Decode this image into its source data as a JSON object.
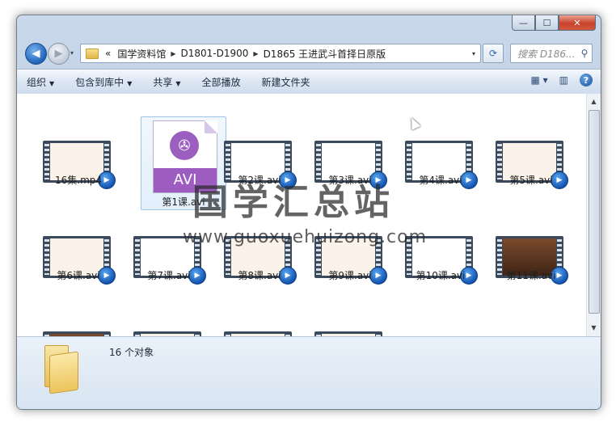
{
  "window": {
    "caption_buttons": {
      "minimize": "—",
      "maximize": "☐",
      "close": "✕"
    }
  },
  "address": {
    "recent_arrow": "▾",
    "overflow": "«",
    "crumbs": [
      "国学资料馆",
      "D1801-D1900",
      "D1865 王进武斗首择日原版"
    ],
    "dropdown": "▾"
  },
  "search": {
    "placeholder": "搜索 D186..."
  },
  "toolbar": {
    "organize": "组织",
    "include_library": "包含到库中",
    "share": "共享",
    "play_all": "全部播放",
    "new_folder": "新建文件夹"
  },
  "files": [
    {
      "name": "16集.mp4",
      "thumb": "doc"
    },
    {
      "name": "第1课.avi",
      "thumb": "avi-icon"
    },
    {
      "name": "第2课.avi",
      "thumb": "blank"
    },
    {
      "name": "第3课.avi",
      "thumb": "blank"
    },
    {
      "name": "第4课.avi",
      "thumb": "blank"
    },
    {
      "name": "第5课.avi",
      "thumb": "doc"
    },
    {
      "name": "第6课.avi",
      "thumb": "doc"
    },
    {
      "name": "第7课.avi",
      "thumb": "blank"
    },
    {
      "name": "第8课.avi",
      "thumb": "doc"
    },
    {
      "name": "第9课.avi",
      "thumb": "doc"
    },
    {
      "name": "第10课.avi",
      "thumb": "blank"
    },
    {
      "name": "第11课.avi",
      "thumb": "dark"
    }
  ],
  "avi_icon_text": "AVI",
  "watermark": {
    "cn": "国学汇总站",
    "url": "www.guoxuehuizong.com"
  },
  "status": {
    "count": "16 个对象"
  }
}
